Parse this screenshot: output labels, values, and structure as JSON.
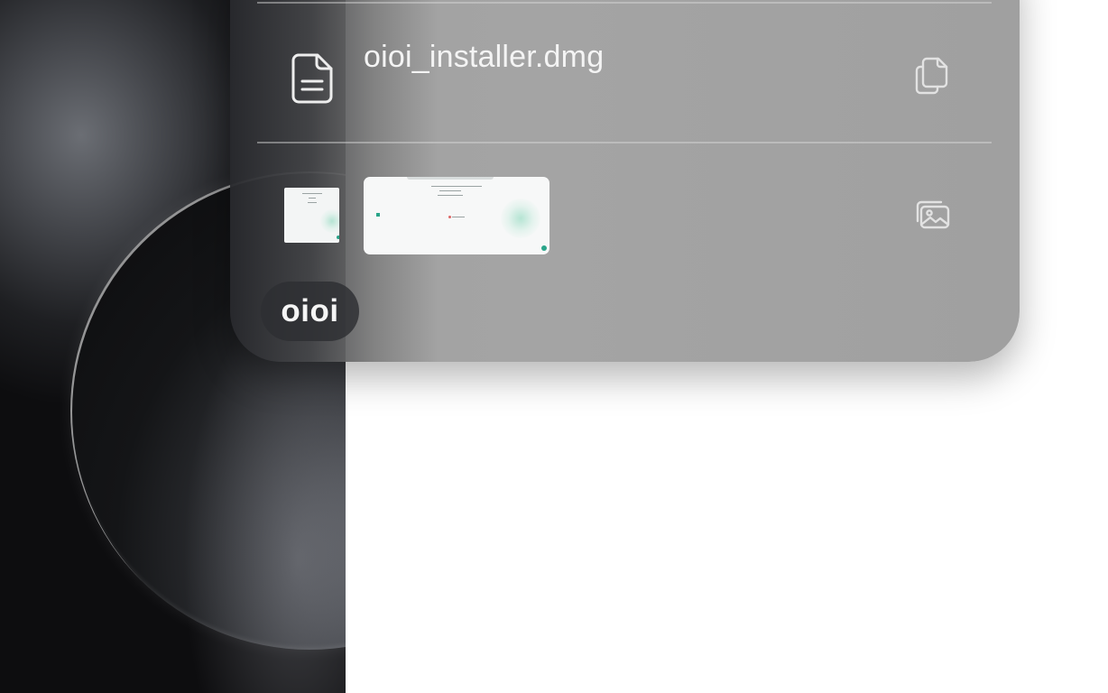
{
  "clipboard": {
    "items": [
      {
        "kind": "file",
        "name": "oioi_installer.dmg",
        "type_icon": "document-icon",
        "action_icon": "copy-files-icon"
      },
      {
        "kind": "images",
        "image_count": 2,
        "action_icon": "photo-gallery-icon"
      }
    ]
  },
  "app": {
    "name": "oioi"
  },
  "colors": {
    "panel": "#a0a0a0",
    "badge": "#2d2e32",
    "text": "#f4f4f4",
    "accent": "#2aa58a"
  }
}
